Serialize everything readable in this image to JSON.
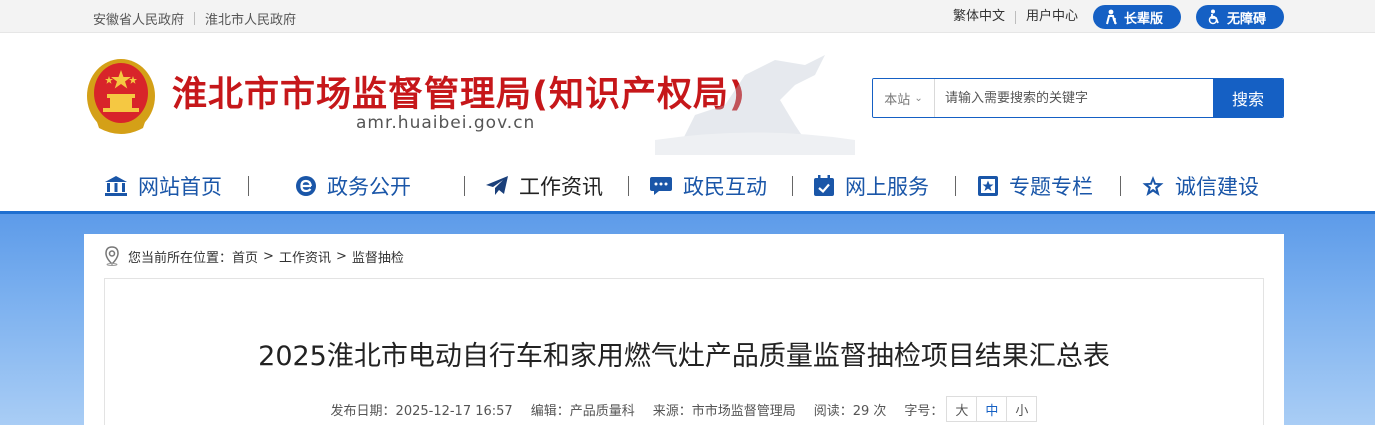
{
  "topbar": {
    "links": [
      "安徽省人民政府",
      "淮北市人民政府"
    ],
    "right_links": [
      "繁体中文",
      "用户中心"
    ],
    "elder_label": "长辈版",
    "access_label": "无障碍"
  },
  "header": {
    "title": "淮北市市场监督管理局(知识产权局)",
    "url": "amr.huaibei.gov.cn"
  },
  "search": {
    "scope": "本站",
    "placeholder": "请输入需要搜索的关键字",
    "button": "搜索"
  },
  "nav": {
    "items": [
      {
        "label": "网站首页",
        "icon": "bank-icon"
      },
      {
        "label": "政务公开",
        "icon": "e-gov-icon"
      },
      {
        "label": "工作资讯",
        "icon": "paper-plane-icon"
      },
      {
        "label": "政民互动",
        "icon": "chat-icon"
      },
      {
        "label": "网上服务",
        "icon": "calendar-check-icon"
      },
      {
        "label": "专题专栏",
        "icon": "star-badge-icon"
      },
      {
        "label": "诚信建设",
        "icon": "star-icon"
      }
    ],
    "active_index": 2
  },
  "breadcrumb": {
    "prefix": "您当前所在位置：",
    "items": [
      "首页",
      "工作资讯",
      "监督抽检"
    ],
    "separator": ">"
  },
  "article": {
    "title": "2025淮北市电动自行车和家用燃气灶产品质量监督抽检项目结果汇总表",
    "publish": "发布日期：2025-12-17 16:57",
    "editor": "编辑：产品质量科",
    "source": "来源：市市场监督管理局",
    "reads": "阅读：29 次",
    "font_label": "字号：",
    "font_sizes": [
      "大",
      "中",
      "小"
    ]
  },
  "colors": {
    "brand_blue": "#1560c4",
    "title_red": "#c6171a",
    "nav_blue": "#1a56a8"
  }
}
